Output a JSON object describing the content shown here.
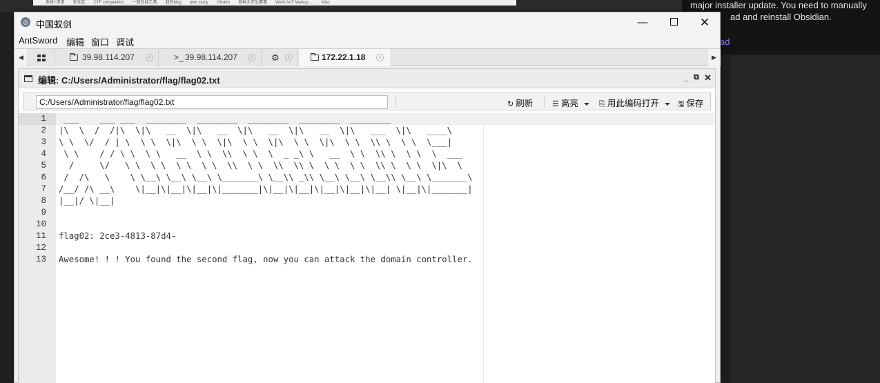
{
  "background": {
    "notice_lines": [
      "major installer update. You need to manually",
      "ad and reinstall Obsidian."
    ],
    "notice_link": "ad",
    "bookmarks": [
      "系统+渗透",
      "安全区",
      "CTF competition",
      "一些在线工具",
      "我的blog",
      "pwn study",
      "Ohsidn",
      "各种大学生赛事",
      "WeKi AnT Markup ...",
      "Misc"
    ]
  },
  "window": {
    "title": "中国蚁剑",
    "min_glyph": "—",
    "close_glyph": "✕"
  },
  "menu": [
    "AntSword",
    "编辑",
    "窗口",
    "调试"
  ],
  "tabs": {
    "left_arrow": "◀",
    "right_arrow": "▶",
    "items": [
      {
        "icon": "grid-icon",
        "label": ""
      },
      {
        "icon": "folder-icon",
        "label": "39.98.114.207"
      },
      {
        "icon": "terminal-icon",
        "prefix": ">_",
        "label": "39.98.114.207"
      },
      {
        "icon": "gear-icon",
        "glyph": "⚙",
        "label": ""
      },
      {
        "icon": "folder-icon",
        "label": "172.22.1.18",
        "active": true
      }
    ],
    "close_glyph": "×"
  },
  "panel": {
    "title": "编辑: C:/Users/Administrator/flag/flag02.txt",
    "controls": [
      "_",
      "⧉",
      "✕"
    ]
  },
  "toolbar": {
    "path": "C:/Users/Administrator/flag/flag02.txt",
    "refresh_icon": "↻",
    "refresh": "刷新",
    "highlight_icon": "☰",
    "highlight": "高亮",
    "open_icon": "⎘",
    "open_with_encoding": "用此编码打开",
    "save_icon": "🖫",
    "save": "保存"
  },
  "editor": {
    "current_line": 1,
    "lines": [
      " ___    ___ ___  ________  ________  ________  ________  ________",
      "|\\  \\  /  /|\\  \\|\\   __  \\|\\   __  \\|\\   __  \\|\\   __  \\|\\   ___  \\|\\   ____\\",
      "\\ \\  \\/  / | \\  \\ \\  \\|\\  \\ \\  \\|\\  \\ \\  \\|\\  \\ \\  \\|\\  \\ \\  \\\\ \\  \\ \\  \\___|",
      " \\ \\    / / \\ \\  \\ \\   __  \\ \\  \\\\  \\ \\  \\  _ _\\ \\   __  \\ \\  \\\\ \\  \\ \\  \\  ___",
      "  /     \\/   \\ \\  \\ \\  \\ \\  \\ \\  \\\\  \\ \\  \\\\  \\\\ \\  \\ \\  \\ \\  \\\\ \\  \\ \\  \\|\\  \\",
      " /  /\\   \\    \\ \\__\\ \\__\\ \\__\\ \\_______\\ \\__\\\\ _\\\\ \\__\\ \\__\\ \\__\\\\ \\__\\ \\_______\\",
      "/__/ /\\ __\\    \\|__|\\|__|\\|__|\\|_______|\\|__|\\|__|\\|__|\\|__|\\|__| \\|__|\\|_______|",
      "|__|/ \\|__|",
      "",
      "",
      "flag02: 2ce3-4813-87d4-",
      "",
      "Awesome! ! ! You found the second flag, now you can attack the domain controller."
    ]
  }
}
